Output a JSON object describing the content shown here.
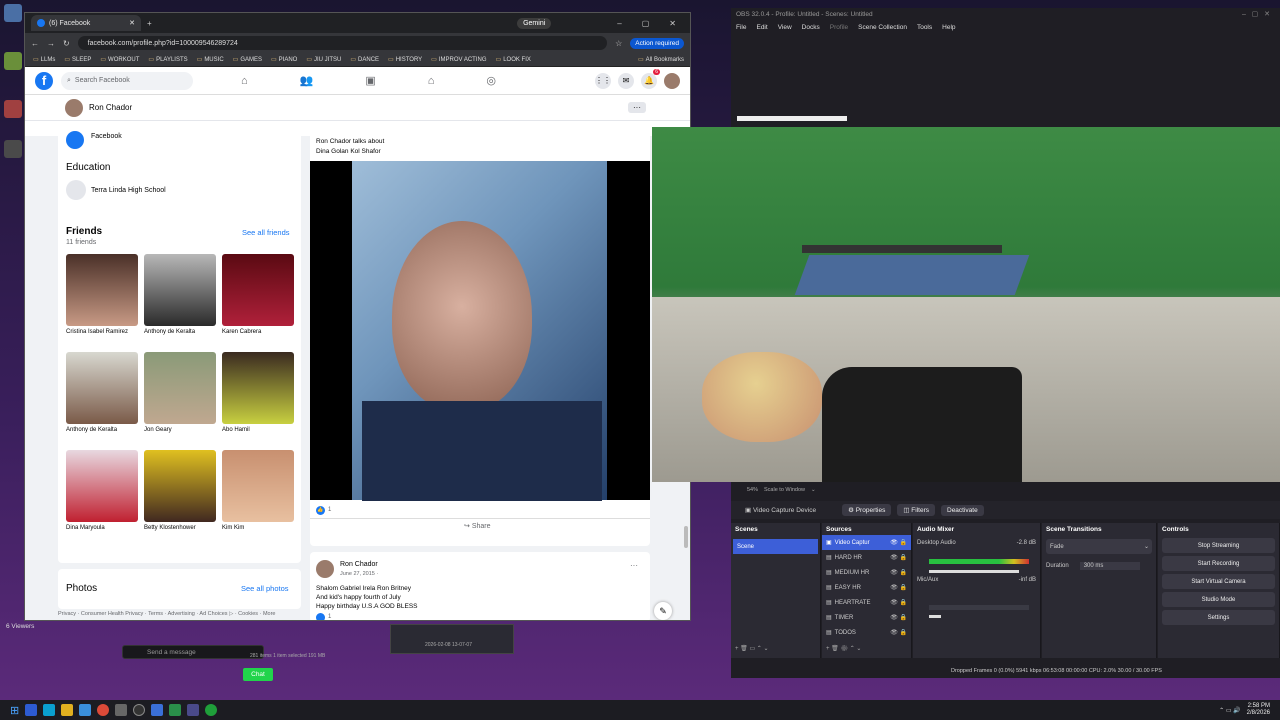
{
  "chrome": {
    "tab_title": "(6) Facebook",
    "gemini": "Gemini",
    "url": "facebook.com/profile.php?id=100009546289724",
    "action_required": "Action required",
    "bookmarks": [
      "LLMs",
      "SLEEP",
      "WORKOUT",
      "PLAYLISTS",
      "MUSIC",
      "GAMES",
      "PIANO",
      "JIU JITSU",
      "DANCE",
      "HISTORY",
      "IMPROV ACTING",
      "LOOK FIX"
    ],
    "all_bookmarks": "All Bookmarks"
  },
  "facebook": {
    "search_placeholder": "Search Facebook",
    "notif_badge": "6",
    "profile_name": "Ron Chador",
    "facebook_label": "Facebook",
    "education_title": "Education",
    "school": "Terra Linda High School",
    "friends_title": "Friends",
    "friends_count": "11 friends",
    "see_all_friends": "See all friends",
    "friends": [
      {
        "name": "Cristina Isabel Ramirez"
      },
      {
        "name": "Anthony de Keralta"
      },
      {
        "name": "Karen Cabrera"
      },
      {
        "name": "Anthony de Keralta"
      },
      {
        "name": "Jon Geary"
      },
      {
        "name": "Abo Hamil"
      },
      {
        "name": "Dina Maryoula"
      },
      {
        "name": "Betty Klostenhower"
      },
      {
        "name": "Kim Kim"
      }
    ],
    "photos_title": "Photos",
    "see_all_photos": "See all photos",
    "footer": "Privacy · Consumer Health Privacy · Terms · Advertising · Ad Choices ▷ · Cookies · More",
    "post1": {
      "header_line1": "Ron Chador talks about",
      "header_line2": "Dina Golan Kol Shafor",
      "likes": "1",
      "share": "Share"
    },
    "post2": {
      "author": "Ron Chador",
      "date": "June 27, 2015 · ",
      "line1": "Shalom Gabriel Irela Ron Britney",
      "line2": "And kid's happy fourth of July",
      "line3": "Happy birthday U.S.A GOD BLESS",
      "likes": "1"
    }
  },
  "obs": {
    "title": "OBS 32.0.4 - Profile: Untitled - Scenes: Untitled",
    "menu": [
      "File",
      "Edit",
      "View",
      "Docks",
      "Profile",
      "Scene Collection",
      "Tools",
      "Help"
    ],
    "selected_source": "Video Capture Device",
    "btn_properties": "Properties",
    "btn_filters": "Filters",
    "btn_deactivate": "Deactivate",
    "scenes_title": "Scenes",
    "scenes": [
      "Scene"
    ],
    "sources_title": "Sources",
    "sources": [
      "Video Captur",
      "HARD HR",
      "MEDIUM HR",
      "EASY HR",
      "HEARTRATE",
      "TIMER",
      "TODOS"
    ],
    "mixer_title": "Audio Mixer",
    "mixer": [
      {
        "name": "Desktop Audio",
        "db": "-2.8 dB"
      },
      {
        "name": "Mic/Aux",
        "db": "-inf dB"
      }
    ],
    "transitions_title": "Scene Transitions",
    "transition": "Fade",
    "duration_label": "Duration",
    "duration": "300 ms",
    "controls_title": "Controls",
    "controls": [
      "Stop Streaming",
      "Start Recording",
      "Start Virtual Camera",
      "Studio Mode",
      "Settings"
    ],
    "status": "Dropped Frames 0 (0.0%)   5941 kbps   06:53:08   00:00:00   CPU: 2.0%   30.00 / 30.00 FPS",
    "scale_label": "Scale to Window",
    "zoom": "54%"
  },
  "chat": {
    "viewers": "6 Viewers",
    "send_placeholder": "Send a message",
    "chat_button": "Chat"
  },
  "explorer": {
    "status": "281 items   1 item selected  191 MB"
  },
  "thumb_caption": "2026-02-08 13-07-07",
  "clock": {
    "time": "2:58 PM",
    "date": "2/8/2026"
  },
  "colors": {
    "fb_blue": "#1877f2",
    "obs_select": "#3d5fd8",
    "chat_green": "#21d44b"
  }
}
